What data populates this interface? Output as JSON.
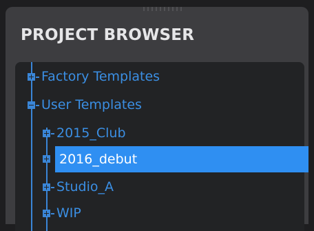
{
  "panel": {
    "title": "PROJECT BROWSER"
  },
  "tree": {
    "items": [
      {
        "label": "Factory Templates",
        "expanded": false,
        "level": 0,
        "selected": false
      },
      {
        "label": "User Templates",
        "expanded": true,
        "level": 0,
        "selected": false
      },
      {
        "label": "2015_Club",
        "expanded": false,
        "level": 1,
        "selected": false
      },
      {
        "label": "2016_debut",
        "expanded": false,
        "level": 1,
        "selected": true
      },
      {
        "label": "Studio_A",
        "expanded": false,
        "level": 1,
        "selected": false
      },
      {
        "label": "WIP",
        "expanded": false,
        "level": 1,
        "selected": false
      }
    ]
  },
  "colors": {
    "accent": "#3b8fe4",
    "selection": "#2f8ff2",
    "panel_bg": "#3d3d40",
    "tree_bg": "#222325"
  }
}
